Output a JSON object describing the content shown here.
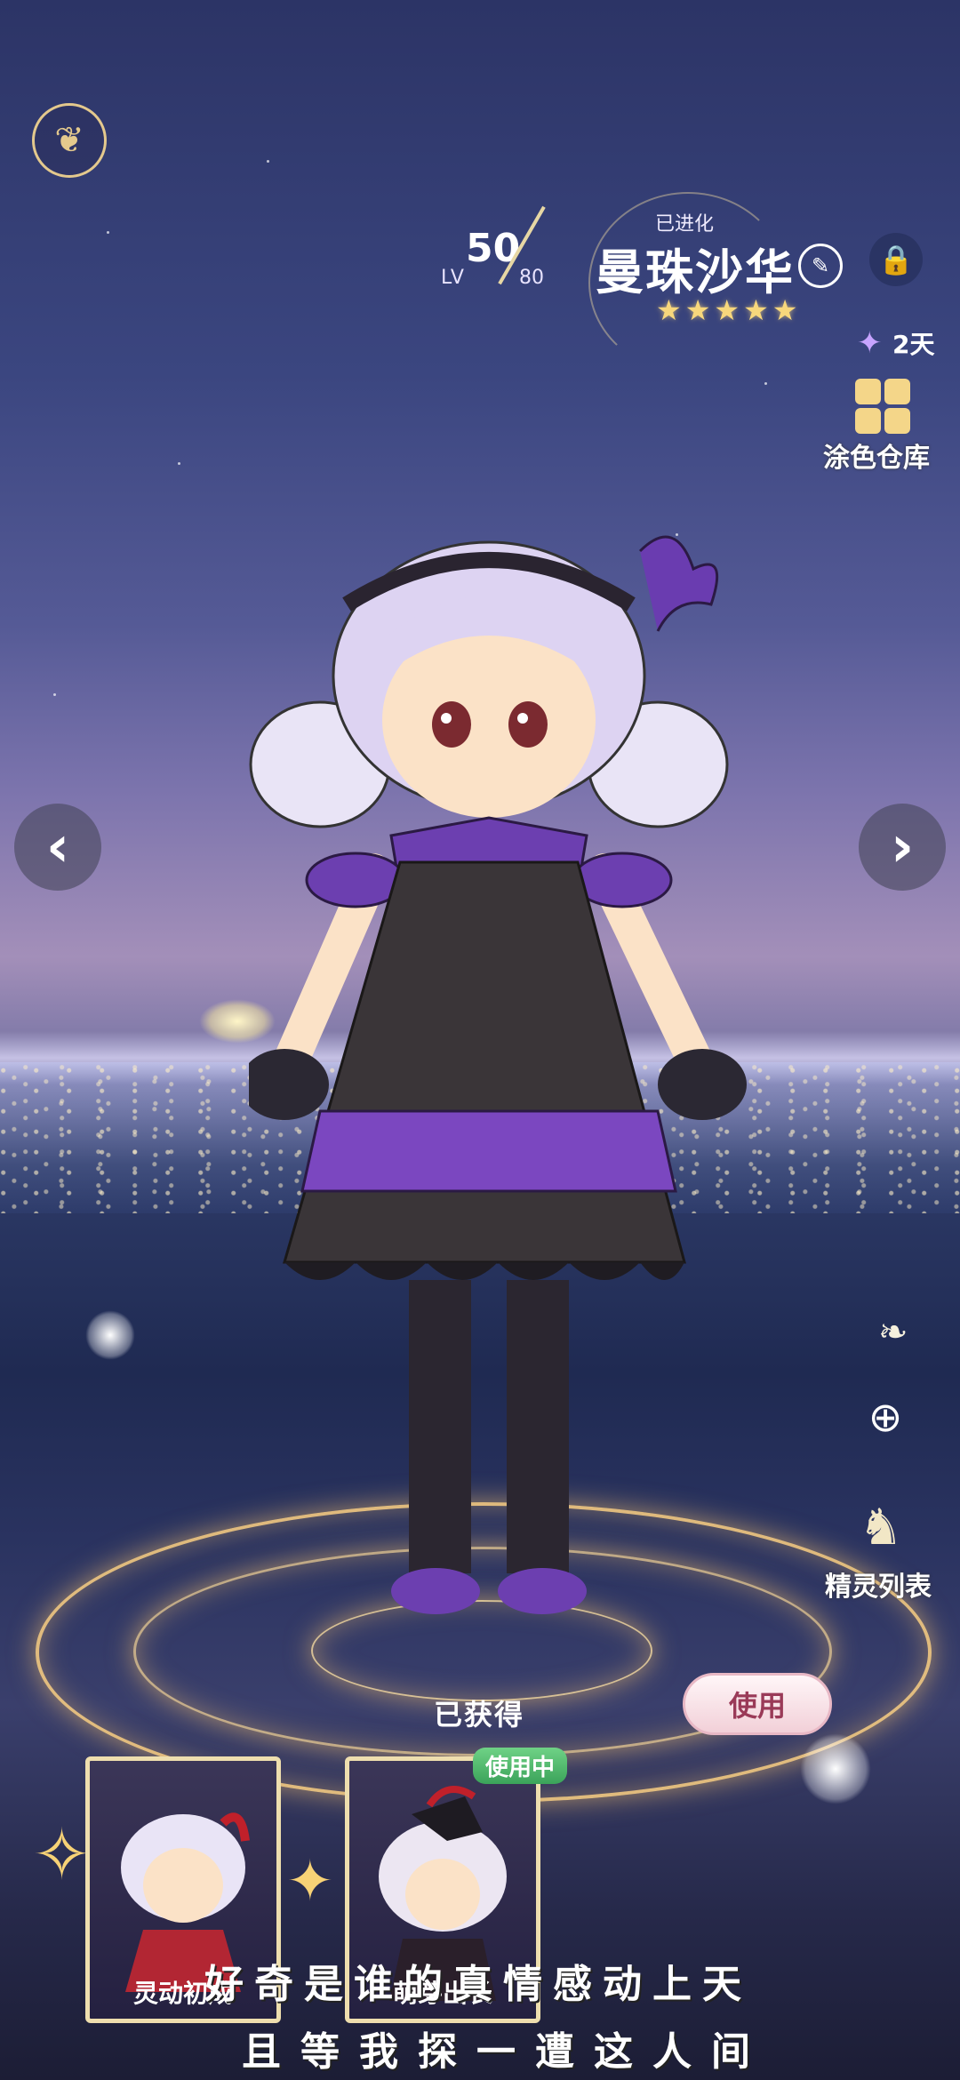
{
  "header": {
    "level": "50",
    "level_label": "LV",
    "level_max": "80",
    "evolved_label": "已进化",
    "character_name": "曼珠沙华",
    "star_count": 5
  },
  "sidebar_right": {
    "duration": "2天",
    "color_storage_label": "涂色仓库",
    "spirit_list_label": "精灵列表"
  },
  "status": {
    "obtained_label": "已获得",
    "use_button_label": "使用"
  },
  "cards": [
    {
      "name": "灵动初成"
    },
    {
      "name": "萌芽出长",
      "badge": "使用中"
    }
  ],
  "lyrics": {
    "line1": "好奇是谁的真情感动上天",
    "line2": "且等我探一遭这人间"
  },
  "colors": {
    "accent_gold": "#e4c98d",
    "dress_purple": "#6b3aa8",
    "badge_green": "#4db866"
  }
}
